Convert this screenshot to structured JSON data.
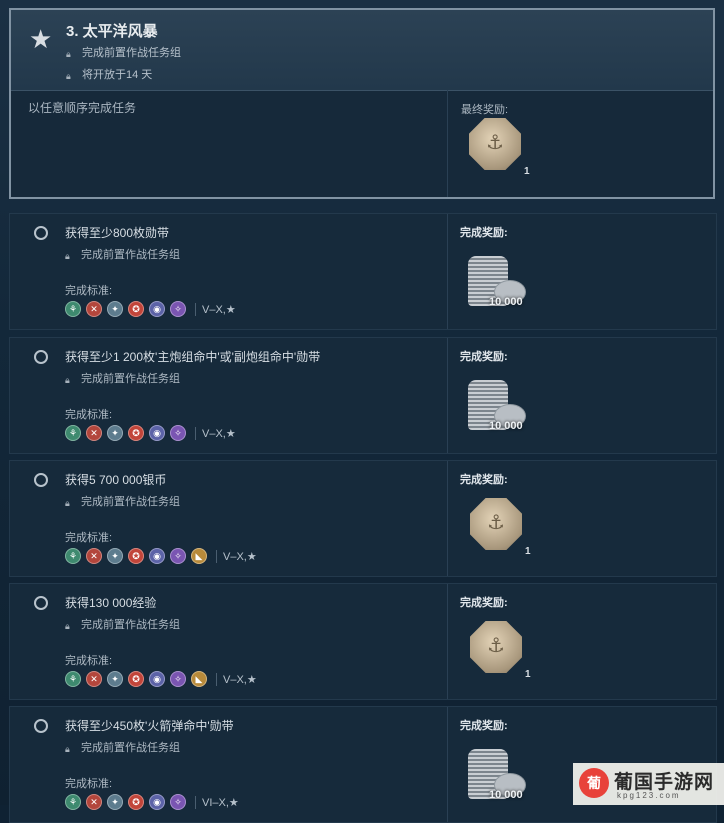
{
  "header": {
    "star_icon": "star-icon",
    "title": "3. 太平洋风暴",
    "line1": "完成前置作战任务组",
    "line2": "将开放于14 天",
    "order_text": "以任意顺序完成任务",
    "final_reward_label": "最终奖励:",
    "final_reward_count": "1"
  },
  "tasks": [
    {
      "title": "获得至少800枚勋带",
      "locked_text": "完成前置作战任务组",
      "criteria_label": "完成标准:",
      "tier_text": "V–X,★",
      "reward_label": "完成奖励:",
      "reward_type": "coins",
      "reward_amount": "10 000"
    },
    {
      "title": "获得至少1 200枚'主炮组命中'或'副炮组命中'勋带",
      "locked_text": "完成前置作战任务组",
      "criteria_label": "完成标准:",
      "tier_text": "V–X,★",
      "reward_label": "完成奖励:",
      "reward_type": "coins",
      "reward_amount": "10 000"
    },
    {
      "title": "获得5 700 000银币",
      "locked_text": "完成前置作战任务组",
      "criteria_label": "完成标准:",
      "tier_text": "V–X,★",
      "reward_label": "完成奖励:",
      "reward_type": "medal",
      "reward_amount": "1"
    },
    {
      "title": "获得130 000经验",
      "locked_text": "完成前置作战任务组",
      "criteria_label": "完成标准:",
      "tier_text": "V–X,★",
      "reward_label": "完成奖励:",
      "reward_type": "medal",
      "reward_amount": "1"
    },
    {
      "title": "获得至少450枚'火箭弹命中'勋带",
      "locked_text": "完成前置作战任务组",
      "criteria_label": "完成标准:",
      "tier_text": "VI–X,★",
      "reward_label": "完成奖励:",
      "reward_type": "coins",
      "reward_amount": "10 000"
    }
  ],
  "ship_class_colors": [
    "#3e8a6f",
    "#b3463c",
    "#5d7c8e",
    "#c2453a",
    "#5c63a8",
    "#7a55b2",
    "#b88a3a"
  ],
  "watermark": {
    "name": "葡国手游网",
    "url": "kpg123.com"
  }
}
